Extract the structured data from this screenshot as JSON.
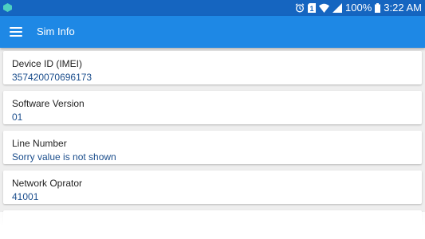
{
  "status_bar": {
    "time": "3:22 AM",
    "battery": "100%",
    "left_icon": "app-notification-icon",
    "icons": [
      "alarm-icon",
      "sim-icon",
      "wifi-icon",
      "signal-icon",
      "battery-icon"
    ],
    "sim_number": "1"
  },
  "app_bar": {
    "title": "Sim Info",
    "menu_icon": "hamburger-menu-icon"
  },
  "items": [
    {
      "label": "Device ID (IMEI)",
      "value": "357420070696173"
    },
    {
      "label": "Software Version",
      "value": "01"
    },
    {
      "label": "Line Number",
      "value": "Sorry value is not shown"
    },
    {
      "label": "Network Oprator",
      "value": "41001"
    }
  ],
  "colors": {
    "status_bar": "#1565c0",
    "app_bar": "#1e88e5",
    "value_text": "#1a4d8c",
    "background": "#eeeeee"
  }
}
